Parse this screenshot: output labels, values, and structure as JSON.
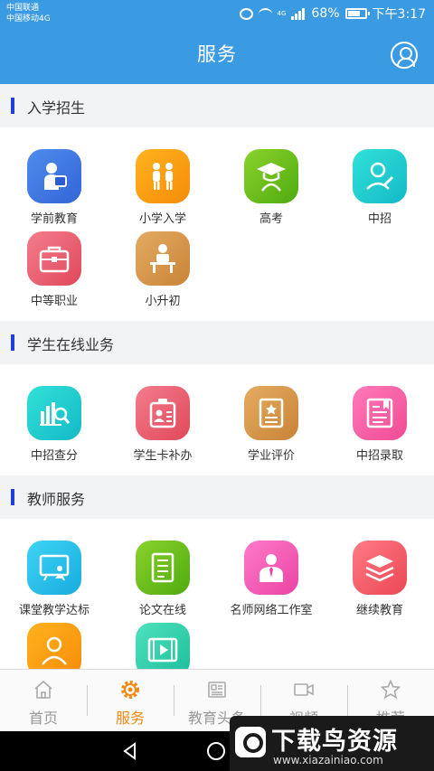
{
  "status": {
    "carrier_1": "中国联通",
    "carrier_2": "中国移动4G",
    "lte": "4G",
    "battery": "68%",
    "time": "下午3:17"
  },
  "header": {
    "title": "服务"
  },
  "sections": [
    {
      "title": "入学招生",
      "items": [
        {
          "label": "学前教育",
          "icon": "reading-child-icon",
          "color": "#3f78e3"
        },
        {
          "label": "小学入学",
          "icon": "pupils-icon",
          "color": "#f9a013"
        },
        {
          "label": "高考",
          "icon": "graduation-cap-icon",
          "color": "#6cbf1b"
        },
        {
          "label": "中招",
          "icon": "student-pen-icon",
          "color": "#1fcbd0"
        },
        {
          "label": "中等职业",
          "icon": "briefcase-icon",
          "color": "#e95d6f"
        },
        {
          "label": "小升初",
          "icon": "student-desk-icon",
          "color": "#d6974b"
        }
      ]
    },
    {
      "title": "学生在线业务",
      "items": [
        {
          "label": "中招查分",
          "icon": "chart-search-icon",
          "color": "#1fcbd0"
        },
        {
          "label": "学生卡补办",
          "icon": "id-card-icon",
          "color": "#e95d6f"
        },
        {
          "label": "学业评价",
          "icon": "certificate-icon",
          "color": "#d6974b"
        },
        {
          "label": "中招录取",
          "icon": "book-bookmark-icon",
          "color": "#f25ea6"
        }
      ]
    },
    {
      "title": "教师服务",
      "items": [
        {
          "label": "课堂教学达标",
          "icon": "blackboard-icon",
          "color": "#28bfea"
        },
        {
          "label": "论文在线",
          "icon": "document-lines-icon",
          "color": "#6cbf1b"
        },
        {
          "label": "名师网络工作室",
          "icon": "teacher-tie-icon",
          "color": "#f25eb6"
        },
        {
          "label": "继续教育",
          "icon": "books-stack-icon",
          "color": "#f0606b"
        },
        {
          "label": "",
          "icon": "person-profile-icon",
          "color": "#f9a013"
        },
        {
          "label": "",
          "icon": "video-film-icon",
          "color": "#2fcfa9"
        }
      ]
    }
  ],
  "tabbar": [
    {
      "label": "首页",
      "icon": "home-icon",
      "active": false
    },
    {
      "label": "服务",
      "icon": "gear-icon",
      "active": true
    },
    {
      "label": "教育头条",
      "icon": "newspaper-icon",
      "active": false
    },
    {
      "label": "视频",
      "icon": "video-camera-icon",
      "active": false
    },
    {
      "label": "推荐",
      "icon": "star-icon",
      "active": false
    }
  ],
  "watermark": {
    "title": "下载鸟资源",
    "url": "www.xiazainiao.com"
  }
}
